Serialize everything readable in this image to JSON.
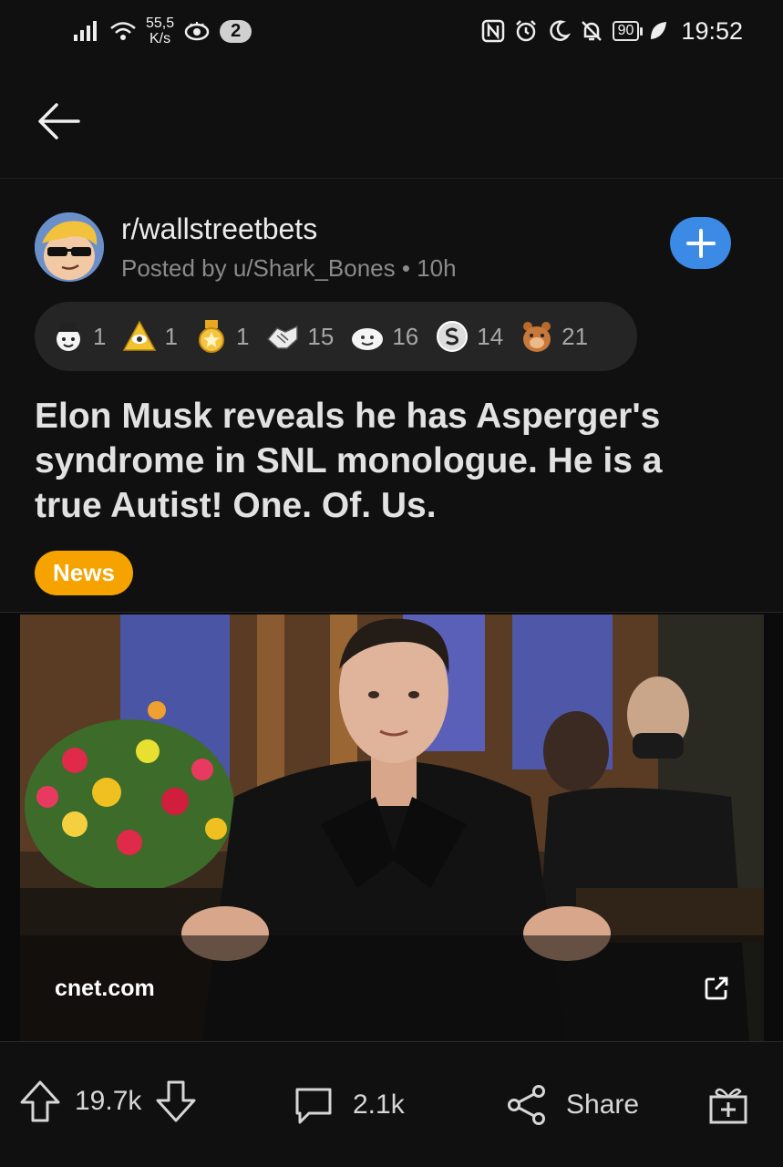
{
  "status_bar": {
    "signal_icon": "signal-bars-icon",
    "wifi_icon": "wifi-icon",
    "net_speed_value": "55,5",
    "net_speed_unit": "K/s",
    "eye_icon": "eye-icon",
    "notification_count": "2",
    "nfc_icon": "nfc-icon",
    "alarm_icon": "alarm-icon",
    "dnd_icon": "moon-icon",
    "mute_icon": "bell-off-icon",
    "battery": "90",
    "leaf_icon": "leaf-icon",
    "time": "19:52"
  },
  "topbar": {
    "back_icon": "arrow-left-icon"
  },
  "post": {
    "subreddit": "r/wallstreetbets",
    "posted_by": "Posted by u/Shark_Bones • 10h",
    "join_icon": "plus-icon",
    "awards": [
      {
        "icon": "wholesome-award-icon",
        "count": "1"
      },
      {
        "icon": "illuminati-award-icon",
        "count": "1"
      },
      {
        "icon": "star-medal-award-icon",
        "count": "1"
      },
      {
        "icon": "handshake-award-icon",
        "count": "15"
      },
      {
        "icon": "cloud-face-award-icon",
        "count": "16"
      },
      {
        "icon": "silver-coin-award-icon",
        "count": "14"
      },
      {
        "icon": "bear-award-icon",
        "count": "21"
      }
    ],
    "title": "Elon Musk reveals he has Asperger's syndrome in SNL monologue. He is a true Autist! One. Of. Us.",
    "flair": "News",
    "flair_color": "#f6a300",
    "link_domain": "cnet.com",
    "external_link_icon": "external-link-icon"
  },
  "actions": {
    "upvote_icon": "arrow-up-icon",
    "score": "19.7k",
    "downvote_icon": "arrow-down-icon",
    "comment_icon": "comment-bubble-icon",
    "comments": "2.1k",
    "share_icon": "share-icon",
    "share_label": "Share",
    "gift_icon": "gift-icon"
  },
  "colors": {
    "background": "#101010",
    "accent": "#3b8be6"
  }
}
